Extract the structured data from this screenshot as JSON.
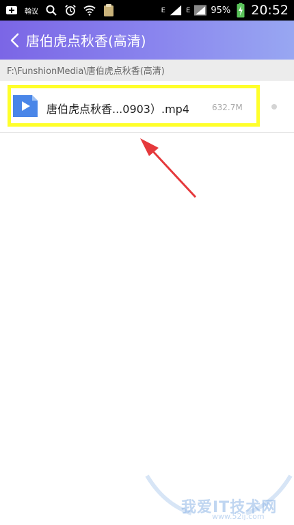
{
  "status_bar": {
    "notification_label": "翰议",
    "signal_label_1": "E",
    "signal_label_2": "E",
    "battery_percent": "95%",
    "time": "20:52"
  },
  "header": {
    "title": "唐伯虎点秋香(高清)"
  },
  "path": {
    "text": "F:\\FunshionMedia\\唐伯虎点秋香(高清)"
  },
  "files": [
    {
      "name": "唐伯虎点秋香...0903）.mp4",
      "size": "632.7M"
    }
  ],
  "watermark": {
    "text": "我爱IT技术网",
    "subtext": "www.52ij.com"
  },
  "colors": {
    "header_start": "#7b66e6",
    "header_end": "#98a7f2",
    "highlight": "#ffff2a",
    "arrow": "#e5393c",
    "video_icon": "#4a86e8"
  }
}
